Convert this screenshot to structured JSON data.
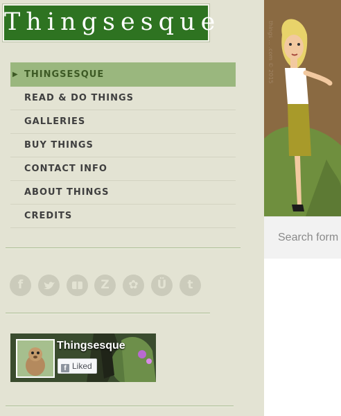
{
  "site": {
    "logo_text": "Thingsesque"
  },
  "menu": {
    "items": [
      {
        "label": "THINGSESQUE",
        "active": true
      },
      {
        "label": "READ & DO THINGS",
        "active": false
      },
      {
        "label": "GALLERIES",
        "active": false
      },
      {
        "label": "BUY THINGS",
        "active": false
      },
      {
        "label": "CONTACT INFO",
        "active": false
      },
      {
        "label": "ABOUT THINGS",
        "active": false
      },
      {
        "label": "CREDITS",
        "active": false
      }
    ],
    "arrow_glyph": "▶"
  },
  "social": {
    "icons": [
      {
        "name": "facebook-icon",
        "glyph": "f"
      },
      {
        "name": "twitter-icon",
        "glyph": "🐦"
      },
      {
        "name": "deviantart-icon",
        "glyph": "✎"
      },
      {
        "name": "zazzle-icon",
        "glyph": "Z"
      },
      {
        "name": "fourleaf-icon",
        "glyph": "✿"
      },
      {
        "name": "unknown-u-icon",
        "glyph": "Ü"
      },
      {
        "name": "tumblr-icon",
        "glyph": "t"
      }
    ],
    "color": "#cbcbbb"
  },
  "facebook": {
    "page_name": "Thingsesque",
    "liked_label": "Liked"
  },
  "banner": {
    "watermark": "things ... .com © 2015"
  },
  "search": {
    "placeholder": "Search form"
  },
  "colors": {
    "sidebar_bg": "#e3e3d3",
    "logo_bg": "#2e7321",
    "active_menu_bg": "#9ab77e"
  }
}
